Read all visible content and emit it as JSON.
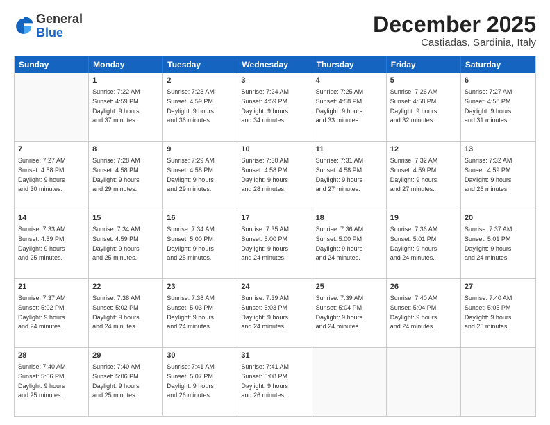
{
  "logo": {
    "general": "General",
    "blue": "Blue"
  },
  "header": {
    "month": "December 2025",
    "location": "Castiadas, Sardinia, Italy"
  },
  "weekdays": [
    "Sunday",
    "Monday",
    "Tuesday",
    "Wednesday",
    "Thursday",
    "Friday",
    "Saturday"
  ],
  "weeks": [
    [
      {
        "day": "",
        "empty": true
      },
      {
        "day": "1",
        "line1": "Sunrise: 7:22 AM",
        "line2": "Sunset: 4:59 PM",
        "line3": "Daylight: 9 hours",
        "line4": "and 37 minutes."
      },
      {
        "day": "2",
        "line1": "Sunrise: 7:23 AM",
        "line2": "Sunset: 4:59 PM",
        "line3": "Daylight: 9 hours",
        "line4": "and 36 minutes."
      },
      {
        "day": "3",
        "line1": "Sunrise: 7:24 AM",
        "line2": "Sunset: 4:59 PM",
        "line3": "Daylight: 9 hours",
        "line4": "and 34 minutes."
      },
      {
        "day": "4",
        "line1": "Sunrise: 7:25 AM",
        "line2": "Sunset: 4:58 PM",
        "line3": "Daylight: 9 hours",
        "line4": "and 33 minutes."
      },
      {
        "day": "5",
        "line1": "Sunrise: 7:26 AM",
        "line2": "Sunset: 4:58 PM",
        "line3": "Daylight: 9 hours",
        "line4": "and 32 minutes."
      },
      {
        "day": "6",
        "line1": "Sunrise: 7:27 AM",
        "line2": "Sunset: 4:58 PM",
        "line3": "Daylight: 9 hours",
        "line4": "and 31 minutes."
      }
    ],
    [
      {
        "day": "7",
        "line1": "Sunrise: 7:27 AM",
        "line2": "Sunset: 4:58 PM",
        "line3": "Daylight: 9 hours",
        "line4": "and 30 minutes."
      },
      {
        "day": "8",
        "line1": "Sunrise: 7:28 AM",
        "line2": "Sunset: 4:58 PM",
        "line3": "Daylight: 9 hours",
        "line4": "and 29 minutes."
      },
      {
        "day": "9",
        "line1": "Sunrise: 7:29 AM",
        "line2": "Sunset: 4:58 PM",
        "line3": "Daylight: 9 hours",
        "line4": "and 29 minutes."
      },
      {
        "day": "10",
        "line1": "Sunrise: 7:30 AM",
        "line2": "Sunset: 4:58 PM",
        "line3": "Daylight: 9 hours",
        "line4": "and 28 minutes."
      },
      {
        "day": "11",
        "line1": "Sunrise: 7:31 AM",
        "line2": "Sunset: 4:58 PM",
        "line3": "Daylight: 9 hours",
        "line4": "and 27 minutes."
      },
      {
        "day": "12",
        "line1": "Sunrise: 7:32 AM",
        "line2": "Sunset: 4:59 PM",
        "line3": "Daylight: 9 hours",
        "line4": "and 27 minutes."
      },
      {
        "day": "13",
        "line1": "Sunrise: 7:32 AM",
        "line2": "Sunset: 4:59 PM",
        "line3": "Daylight: 9 hours",
        "line4": "and 26 minutes."
      }
    ],
    [
      {
        "day": "14",
        "line1": "Sunrise: 7:33 AM",
        "line2": "Sunset: 4:59 PM",
        "line3": "Daylight: 9 hours",
        "line4": "and 25 minutes."
      },
      {
        "day": "15",
        "line1": "Sunrise: 7:34 AM",
        "line2": "Sunset: 4:59 PM",
        "line3": "Daylight: 9 hours",
        "line4": "and 25 minutes."
      },
      {
        "day": "16",
        "line1": "Sunrise: 7:34 AM",
        "line2": "Sunset: 5:00 PM",
        "line3": "Daylight: 9 hours",
        "line4": "and 25 minutes."
      },
      {
        "day": "17",
        "line1": "Sunrise: 7:35 AM",
        "line2": "Sunset: 5:00 PM",
        "line3": "Daylight: 9 hours",
        "line4": "and 24 minutes."
      },
      {
        "day": "18",
        "line1": "Sunrise: 7:36 AM",
        "line2": "Sunset: 5:00 PM",
        "line3": "Daylight: 9 hours",
        "line4": "and 24 minutes."
      },
      {
        "day": "19",
        "line1": "Sunrise: 7:36 AM",
        "line2": "Sunset: 5:01 PM",
        "line3": "Daylight: 9 hours",
        "line4": "and 24 minutes."
      },
      {
        "day": "20",
        "line1": "Sunrise: 7:37 AM",
        "line2": "Sunset: 5:01 PM",
        "line3": "Daylight: 9 hours",
        "line4": "and 24 minutes."
      }
    ],
    [
      {
        "day": "21",
        "line1": "Sunrise: 7:37 AM",
        "line2": "Sunset: 5:02 PM",
        "line3": "Daylight: 9 hours",
        "line4": "and 24 minutes."
      },
      {
        "day": "22",
        "line1": "Sunrise: 7:38 AM",
        "line2": "Sunset: 5:02 PM",
        "line3": "Daylight: 9 hours",
        "line4": "and 24 minutes."
      },
      {
        "day": "23",
        "line1": "Sunrise: 7:38 AM",
        "line2": "Sunset: 5:03 PM",
        "line3": "Daylight: 9 hours",
        "line4": "and 24 minutes."
      },
      {
        "day": "24",
        "line1": "Sunrise: 7:39 AM",
        "line2": "Sunset: 5:03 PM",
        "line3": "Daylight: 9 hours",
        "line4": "and 24 minutes."
      },
      {
        "day": "25",
        "line1": "Sunrise: 7:39 AM",
        "line2": "Sunset: 5:04 PM",
        "line3": "Daylight: 9 hours",
        "line4": "and 24 minutes."
      },
      {
        "day": "26",
        "line1": "Sunrise: 7:40 AM",
        "line2": "Sunset: 5:04 PM",
        "line3": "Daylight: 9 hours",
        "line4": "and 24 minutes."
      },
      {
        "day": "27",
        "line1": "Sunrise: 7:40 AM",
        "line2": "Sunset: 5:05 PM",
        "line3": "Daylight: 9 hours",
        "line4": "and 25 minutes."
      }
    ],
    [
      {
        "day": "28",
        "line1": "Sunrise: 7:40 AM",
        "line2": "Sunset: 5:06 PM",
        "line3": "Daylight: 9 hours",
        "line4": "and 25 minutes."
      },
      {
        "day": "29",
        "line1": "Sunrise: 7:40 AM",
        "line2": "Sunset: 5:06 PM",
        "line3": "Daylight: 9 hours",
        "line4": "and 25 minutes."
      },
      {
        "day": "30",
        "line1": "Sunrise: 7:41 AM",
        "line2": "Sunset: 5:07 PM",
        "line3": "Daylight: 9 hours",
        "line4": "and 26 minutes."
      },
      {
        "day": "31",
        "line1": "Sunrise: 7:41 AM",
        "line2": "Sunset: 5:08 PM",
        "line3": "Daylight: 9 hours",
        "line4": "and 26 minutes."
      },
      {
        "day": "",
        "empty": true
      },
      {
        "day": "",
        "empty": true
      },
      {
        "day": "",
        "empty": true
      }
    ]
  ]
}
